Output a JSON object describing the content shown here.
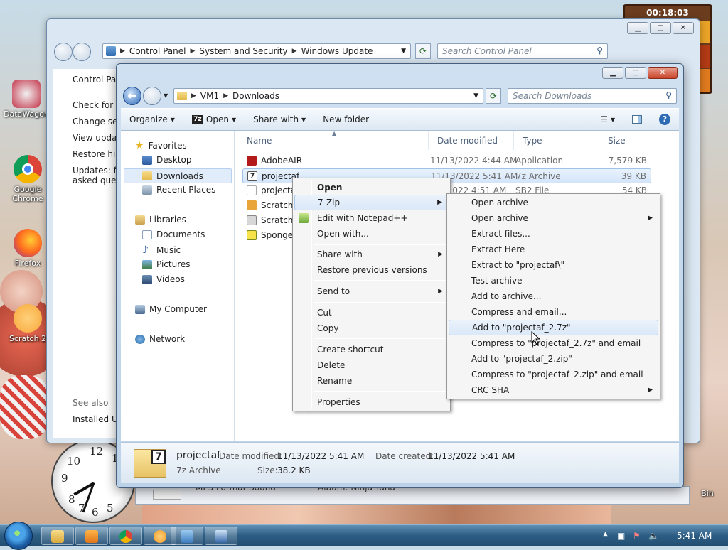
{
  "desktop": {
    "icons": [
      {
        "label": "DataWagon"
      },
      {
        "label": "Google Chrome"
      },
      {
        "label": "Firefox"
      },
      {
        "label": "Scratch 2"
      }
    ],
    "bin_label": "Bin",
    "gadget_timer": "00:18:03"
  },
  "back_window": {
    "breadcrumbs": [
      "Control Panel",
      "System and Security",
      "Windows Update"
    ],
    "search_placeholder": "Search Control Panel",
    "left_links": [
      "Control Panel Home",
      "Check for updates",
      "Change settings",
      "View update history",
      "Restore hidden updates",
      "Updates: frequently asked questions"
    ],
    "see_also": "See also",
    "installed_updates": "Installed Updates",
    "peek_text": "MP3 Format Sound",
    "peek_album": "Album: Ninja Tuna"
  },
  "front_window": {
    "breadcrumbs": [
      "VM1",
      "Downloads"
    ],
    "search_placeholder": "Search Downloads",
    "toolbar": {
      "organize": "Organize",
      "open": "Open",
      "share_with": "Share with",
      "new_folder": "New folder"
    },
    "nav": {
      "favorites": "Favorites",
      "desktop": "Desktop",
      "downloads": "Downloads",
      "recent_places": "Recent Places",
      "libraries": "Libraries",
      "documents": "Documents",
      "music": "Music",
      "pictures": "Pictures",
      "videos": "Videos",
      "my_computer": "My Computer",
      "network": "Network"
    },
    "columns": {
      "name": "Name",
      "date": "Date modified",
      "type": "Type",
      "size": "Size"
    },
    "files": [
      {
        "name": "AdobeAIR",
        "date": "11/13/2022 4:44 AM",
        "type": "Application",
        "size": "7,579 KB"
      },
      {
        "name": "projectaf",
        "date": "11/13/2022 5:41 AM",
        "type": "7z Archive",
        "size": "39 KB"
      },
      {
        "name": "projecta",
        "date": "3/2022 4:51 AM",
        "type": "SB2 File",
        "size": "54 KB"
      },
      {
        "name": "Scratch",
        "date": "",
        "type": "",
        "size": ""
      },
      {
        "name": "Scratch-",
        "date": "",
        "type": "",
        "size": ""
      },
      {
        "name": "Spongel",
        "date": "",
        "type": "",
        "size": ""
      }
    ],
    "details": {
      "filename": "projectaf",
      "filetype": "7z Archive",
      "date_modified_label": "Date modified:",
      "date_modified": "11/13/2022 5:41 AM",
      "size_label": "Size:",
      "size": "38.2 KB",
      "date_created_label": "Date created:",
      "date_created": "11/13/2022 5:41 AM",
      "icon_text": "7"
    }
  },
  "context_menu": {
    "items": [
      "Open",
      "7-Zip",
      "Edit with Notepad++",
      "Open with...",
      "Share with",
      "Restore previous versions",
      "Send to",
      "Cut",
      "Copy",
      "Create shortcut",
      "Delete",
      "Rename",
      "Properties"
    ]
  },
  "zip_submenu": {
    "items": [
      "Open archive",
      "Open archive",
      "Extract files...",
      "Extract Here",
      "Extract to \"projectaf\\\"",
      "Test archive",
      "Add to archive...",
      "Compress and email...",
      "Add to \"projectaf_2.7z\"",
      "Compress to \"projectaf_2.7z\" and email",
      "Add to \"projectaf_2.zip\"",
      "Compress to \"projectaf_2.zip\" and email",
      "CRC SHA"
    ]
  },
  "taskbar": {
    "clock": "5:41 AM"
  }
}
